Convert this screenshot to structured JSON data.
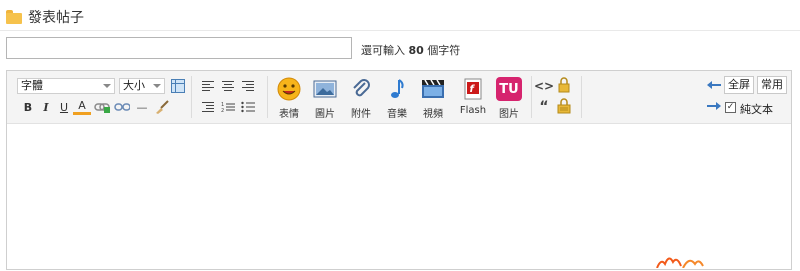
{
  "header": {
    "title": "發表帖子",
    "icon": "folder-icon"
  },
  "subject": {
    "value": "",
    "placeholder": ""
  },
  "hint": {
    "prefix": "還可輸入",
    "count": "80",
    "suffix": "個字符"
  },
  "toolbar": {
    "font_select": "字體",
    "size_select": "大小",
    "format_buttons": {
      "bold": "B",
      "italic": "I",
      "underline": "U",
      "font_color": "A",
      "divider": "—"
    },
    "media": {
      "emoji": "表情",
      "image": "圖片",
      "attachment": "附件",
      "music": "音樂",
      "video": "視頻",
      "flash": "Flash",
      "tu_image": "图片",
      "tu_logo": "TU"
    },
    "code": "<>",
    "quote": "“",
    "fullscreen": "全屏",
    "common": "常用",
    "plaintext": "純文本",
    "plaintext_checked": true
  },
  "colors": {
    "accent_orange": "#f6c24c",
    "flash_red": "#cc1a1a",
    "tu_pink": "#d6246e"
  }
}
